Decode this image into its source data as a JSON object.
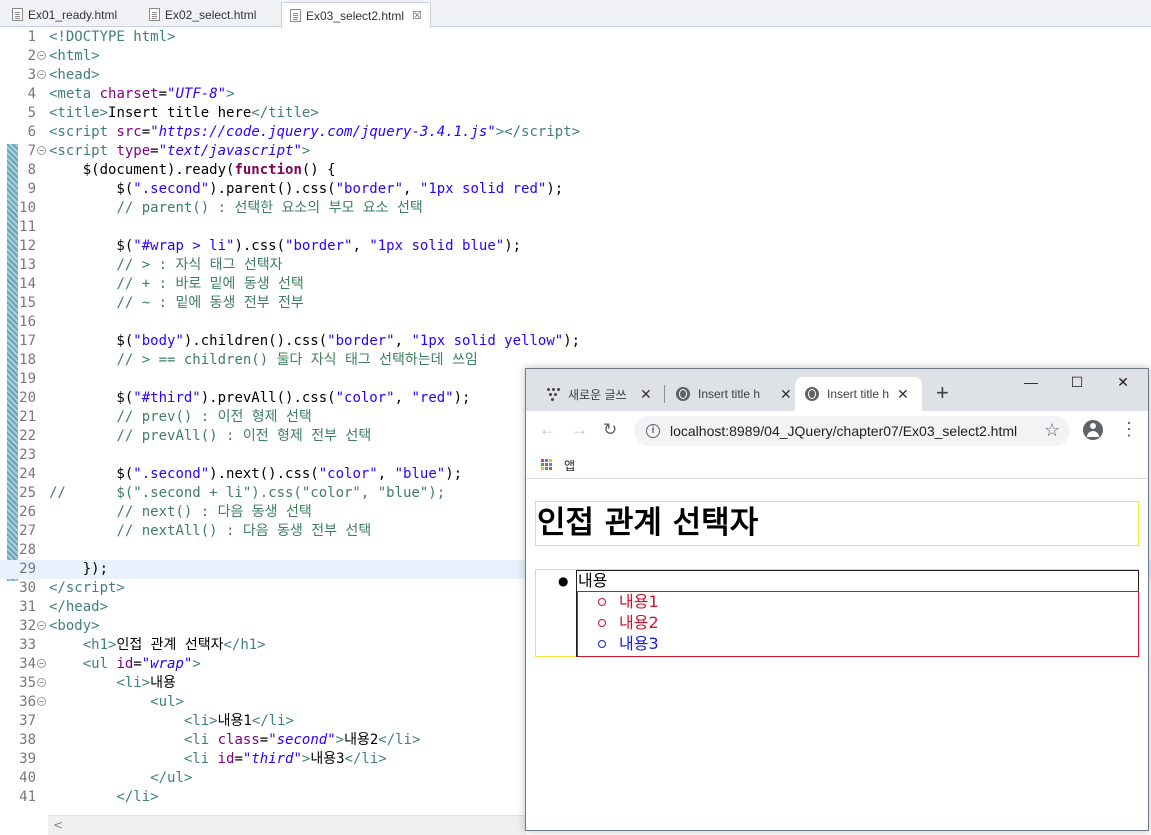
{
  "editor": {
    "tabs": [
      {
        "label": "Ex01_ready.html"
      },
      {
        "label": "Ex02_select.html"
      },
      {
        "label": "Ex03_select2.html",
        "close": "☒"
      }
    ],
    "current_line": 29
  },
  "code_lines": [
    {
      "n": "1",
      "fold": "",
      "html": "<span class=\"t\">&lt;!DOCTYPE html&gt;</span>"
    },
    {
      "n": "2",
      "fold": "⊖",
      "html": "<span class=\"t\">&lt;html&gt;</span>"
    },
    {
      "n": "3",
      "fold": "⊖",
      "html": "<span class=\"t\">&lt;head&gt;</span>"
    },
    {
      "n": "4",
      "fold": "",
      "html": "<span class=\"t\">&lt;meta</span> <span class=\"a\">charset</span>=<span class=\"v\">\"UTF-8\"</span><span class=\"t\">&gt;</span>"
    },
    {
      "n": "5",
      "fold": "",
      "html": "<span class=\"t\">&lt;title&gt;</span>Insert title here<span class=\"t\">&lt;/title&gt;</span>"
    },
    {
      "n": "6",
      "fold": "",
      "html": "<span class=\"t\">&lt;script</span> <span class=\"a\">src</span>=<span class=\"v\">\"https://code.jquery.com/jquery-3.4.1.js\"</span><span class=\"t\">&gt;&lt;/script&gt;</span>"
    },
    {
      "n": "7",
      "fold": "⊖",
      "html": "<span class=\"t\">&lt;script</span> <span class=\"a\">type</span>=<span class=\"v\">\"text/javascript\"</span><span class=\"t\">&gt;</span>"
    },
    {
      "n": "8",
      "fold": "",
      "html": "    $(document).ready(<span class=\"k\">function</span>() {"
    },
    {
      "n": "9",
      "fold": "",
      "html": "        $(<span class=\"s\">\".second\"</span>).parent().css(<span class=\"s\">\"border\"</span>, <span class=\"s\">\"1px solid red\"</span>);"
    },
    {
      "n": "10",
      "fold": "",
      "html": "        <span class=\"c\">// parent() : 선택한 요소의 부모 요소 선택</span>"
    },
    {
      "n": "11",
      "fold": "",
      "html": ""
    },
    {
      "n": "12",
      "fold": "",
      "html": "        $(<span class=\"s\">\"#wrap &gt; li\"</span>).css(<span class=\"s\">\"border\"</span>, <span class=\"s\">\"1px solid blue\"</span>);"
    },
    {
      "n": "13",
      "fold": "",
      "html": "        <span class=\"c\">// &gt; : 자식 태그 선택자</span>"
    },
    {
      "n": "14",
      "fold": "",
      "html": "        <span class=\"c\">// + : 바로 밑에 동생 선택</span>"
    },
    {
      "n": "15",
      "fold": "",
      "html": "        <span class=\"c\">// ~ : 밑에 동생 전부 전부</span>"
    },
    {
      "n": "16",
      "fold": "",
      "html": ""
    },
    {
      "n": "17",
      "fold": "",
      "html": "        $(<span class=\"s\">\"body\"</span>).children().css(<span class=\"s\">\"border\"</span>, <span class=\"s\">\"1px solid yellow\"</span>);"
    },
    {
      "n": "18",
      "fold": "",
      "html": "        <span class=\"c\">// &gt; == children() 둘다 자식 태그 선택하는데 쓰임</span>"
    },
    {
      "n": "19",
      "fold": "",
      "html": ""
    },
    {
      "n": "20",
      "fold": "",
      "html": "        $(<span class=\"s\">\"#third\"</span>).prevAll().css(<span class=\"s\">\"color\"</span>, <span class=\"s\">\"red\"</span>);"
    },
    {
      "n": "21",
      "fold": "",
      "html": "        <span class=\"c\">// prev() : 이전 형제 선택</span>"
    },
    {
      "n": "22",
      "fold": "",
      "html": "        <span class=\"c\">// prevAll() : 이전 형제 전부 선택</span>"
    },
    {
      "n": "23",
      "fold": "",
      "html": ""
    },
    {
      "n": "24",
      "fold": "",
      "html": "        $(<span class=\"s\">\".second\"</span>).next().css(<span class=\"s\">\"color\"</span>, <span class=\"s\">\"blue\"</span>);"
    },
    {
      "n": "25",
      "fold": "",
      "html": "<span class=\"c\">//      $(\".second + li\").css(\"color\", \"blue\");</span>"
    },
    {
      "n": "26",
      "fold": "",
      "html": "        <span class=\"c\">// next() : 다음 동생 선택</span>"
    },
    {
      "n": "27",
      "fold": "",
      "html": "        <span class=\"c\">// nextAll() : 다음 동생 전부 선택</span>"
    },
    {
      "n": "28",
      "fold": "",
      "html": ""
    },
    {
      "n": "29",
      "fold": "",
      "html": "    });"
    },
    {
      "n": "30",
      "fold": "",
      "html": "<span class=\"t\">&lt;/script&gt;</span>"
    },
    {
      "n": "31",
      "fold": "",
      "html": "<span class=\"t\">&lt;/head&gt;</span>"
    },
    {
      "n": "32",
      "fold": "⊖",
      "html": "<span class=\"t\">&lt;body&gt;</span>"
    },
    {
      "n": "33",
      "fold": "",
      "html": "    <span class=\"t\">&lt;h1&gt;</span>인접 관계 선택자<span class=\"t\">&lt;/h1&gt;</span>"
    },
    {
      "n": "34",
      "fold": "⊖",
      "html": "    <span class=\"t\">&lt;ul</span> <span class=\"a\">id</span>=<span class=\"v\">\"wrap\"</span><span class=\"t\">&gt;</span>"
    },
    {
      "n": "35",
      "fold": "⊖",
      "html": "        <span class=\"t\">&lt;li&gt;</span>내용"
    },
    {
      "n": "36",
      "fold": "⊖",
      "html": "            <span class=\"t\">&lt;ul&gt;</span>"
    },
    {
      "n": "37",
      "fold": "",
      "html": "                <span class=\"t\">&lt;li&gt;</span>내용1<span class=\"t\">&lt;/li&gt;</span>"
    },
    {
      "n": "38",
      "fold": "",
      "html": "                <span class=\"t\">&lt;li</span> <span class=\"a\">class</span>=<span class=\"v\">\"second\"</span><span class=\"t\">&gt;</span>내용2<span class=\"t\">&lt;/li&gt;</span>"
    },
    {
      "n": "39",
      "fold": "",
      "html": "                <span class=\"t\">&lt;li</span> <span class=\"a\">id</span>=<span class=\"v\">\"third\"</span><span class=\"t\">&gt;</span>내용3<span class=\"t\">&lt;/li&gt;</span>"
    },
    {
      "n": "40",
      "fold": "",
      "html": "            <span class=\"t\">&lt;/ul&gt;</span>"
    },
    {
      "n": "41",
      "fold": "",
      "html": "        <span class=\"t\">&lt;/li&gt;</span>"
    }
  ],
  "browser": {
    "tabs": [
      {
        "title": "새로운 글쓰",
        "icon": "dots-icon",
        "close": "✕"
      },
      {
        "title": "Insert title h",
        "icon": "globe-icon",
        "close": "✕"
      },
      {
        "title": "Insert title h",
        "icon": "globe-icon",
        "close": "✕"
      }
    ],
    "new_tab": "+",
    "window_controls": {
      "minimize": "—",
      "maximize": "☐",
      "close": "✕"
    },
    "nav": {
      "back": "←",
      "forward": "→",
      "reload": "↻"
    },
    "url": "localhost:8989/04_JQuery/chapter07/Ex03_select2.html",
    "star": "☆",
    "menu": "⋮",
    "bookmarks": {
      "apps_label": "앱"
    },
    "page": {
      "h1": "인접 관계 선택자",
      "outer_item": "내용",
      "outer_bullet": "●",
      "inner_items": [
        {
          "text": "내용1",
          "color": "#d2122e"
        },
        {
          "text": "내용2",
          "color": "#d2122e"
        },
        {
          "text": "내용3",
          "color": "#1a1adb"
        }
      ]
    }
  },
  "colors": {
    "h1_border": "#f3e43a",
    "outer_border": "#1f1f1f",
    "inner_border": "#d2122e"
  }
}
